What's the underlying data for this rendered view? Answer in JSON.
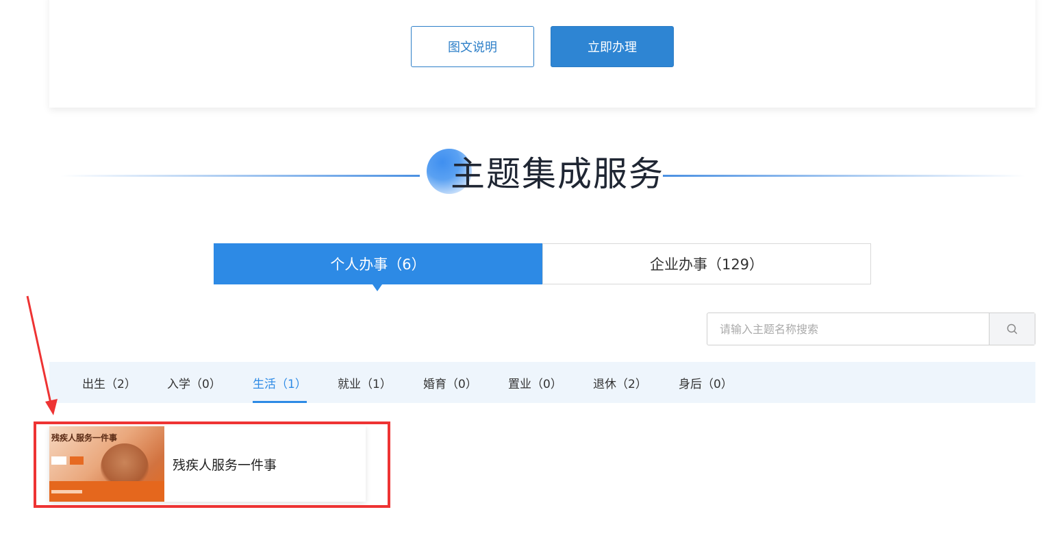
{
  "top_card": {
    "graphic_button": "图文说明",
    "apply_button": "立即办理"
  },
  "section": {
    "title": "主题集成服务"
  },
  "tabs": [
    {
      "label": "个人办事（6）",
      "active": true
    },
    {
      "label": "企业办事（129）",
      "active": false
    }
  ],
  "search": {
    "placeholder": "请输入主题名称搜索",
    "value": ""
  },
  "categories": [
    {
      "label": "出生（2）"
    },
    {
      "label": "入学（0）"
    },
    {
      "label": "生活（1）",
      "active": true
    },
    {
      "label": "就业（1）"
    },
    {
      "label": "婚育（0）"
    },
    {
      "label": "置业（0）"
    },
    {
      "label": "退休（2）"
    },
    {
      "label": "身后（0）"
    }
  ],
  "results": [
    {
      "title": "残疾人服务一件事",
      "thumbnail_caption": "残疾人服务一件事"
    }
  ],
  "colors": {
    "primary": "#2d8ae5",
    "button_primary": "#2e85d3",
    "category_bar_bg": "#eef5fc",
    "annotation_red": "#ee3333"
  }
}
